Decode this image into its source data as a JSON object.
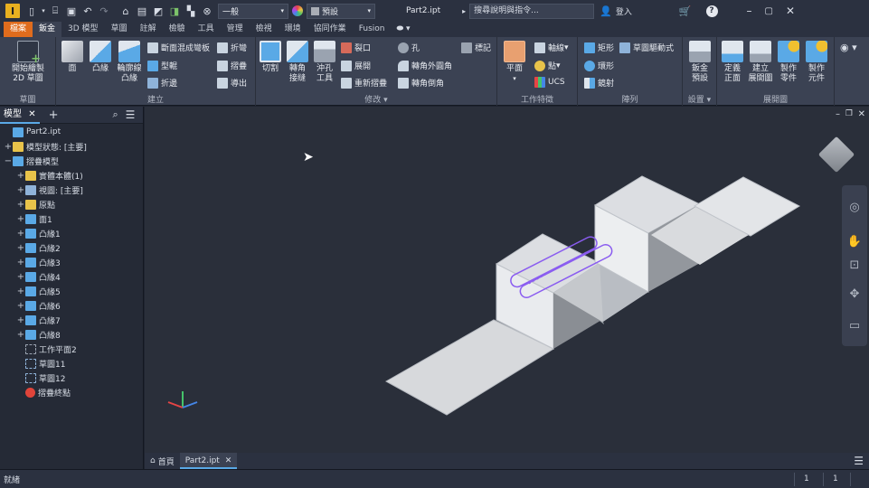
{
  "titlebar": {
    "app_letter": "I",
    "style_select": "一般",
    "appearance_select": "預設",
    "doc_title": "Part2.ipt",
    "search_placeholder": "搜尋說明與指令...",
    "signin": "登入",
    "help_icon": "?"
  },
  "menu_tabs": [
    "檔案",
    "鈑金",
    "3D 模型",
    "草圖",
    "註解",
    "檢驗",
    "工具",
    "管理",
    "檢視",
    "環境",
    "協同作業",
    "Fusion"
  ],
  "ribbon": {
    "sketch_panel": {
      "label": "草圖",
      "start_sketch": "開始繪製\n2D 草圖"
    },
    "create_panel": {
      "label": "建立",
      "face": "面",
      "contour_flange": "凸緣",
      "contour_roll": "輪廓線\n凸緣",
      "lofted_flange": "斷面混成彎板",
      "contour": "型輥",
      "fold": "折邊",
      "bend": "折彎",
      "fold2": "摺疊",
      "export": "導出"
    },
    "modify_panel": {
      "label": "修改",
      "cut": "切割",
      "corner_seam": "轉角\n接縫",
      "punch": "沖孔\n工具",
      "rip": "裂口",
      "unfold": "展開",
      "refold": "重新摺疊",
      "hole": "孔",
      "corner_round": "轉角外圓角",
      "corner_chamfer": "轉角倒角",
      "mark": "標記"
    },
    "work_panel": {
      "label": "工作特徵",
      "plane": "平面",
      "axis": "軸線",
      "point": "點",
      "ucs": "UCS"
    },
    "pattern_panel": {
      "label": "陣列",
      "rect": "矩形",
      "circular": "環形",
      "mirror": "鏡射",
      "sketch_driven": "草圖驅動式"
    },
    "setup_panel": {
      "label": "設置",
      "defaults": "鈑金\n預設"
    },
    "flat_panel": {
      "label": "展開圖",
      "define_face": "定義\n正面",
      "create_flat": "建立\n展開圖",
      "make_part": "製作\n零件",
      "make_component": "製作\n元件"
    }
  },
  "browser": {
    "tab_label": "模型",
    "items": [
      {
        "label": "Part2.ipt",
        "exp": "",
        "indent": 0,
        "icon": "part-icon",
        "color": "#5aa9e6"
      },
      {
        "label": "模型狀態: [主要]",
        "exp": "+",
        "indent": 0,
        "icon": "folder-icon",
        "color": "#e8c34a"
      },
      {
        "label": "摺疊模型",
        "exp": "−",
        "indent": 0,
        "icon": "sheetmetal-icon",
        "color": "#5aa9e6"
      },
      {
        "label": "實體本體(1)",
        "exp": "+",
        "indent": 1,
        "icon": "folder-icon",
        "color": "#e8c34a"
      },
      {
        "label": "視圖: [主要]",
        "exp": "+",
        "indent": 1,
        "icon": "view-icon",
        "color": "#8fb3d9"
      },
      {
        "label": "原點",
        "exp": "+",
        "indent": 1,
        "icon": "folder-icon",
        "color": "#e8c34a"
      },
      {
        "label": "面1",
        "exp": "+",
        "indent": 1,
        "icon": "face-icon",
        "color": "#5aa9e6"
      },
      {
        "label": "凸緣1",
        "exp": "+",
        "indent": 1,
        "icon": "flange-icon",
        "color": "#5aa9e6"
      },
      {
        "label": "凸緣2",
        "exp": "+",
        "indent": 1,
        "icon": "flange-icon",
        "color": "#5aa9e6"
      },
      {
        "label": "凸緣3",
        "exp": "+",
        "indent": 1,
        "icon": "flange-icon",
        "color": "#5aa9e6"
      },
      {
        "label": "凸緣4",
        "exp": "+",
        "indent": 1,
        "icon": "flange-icon",
        "color": "#5aa9e6"
      },
      {
        "label": "凸緣5",
        "exp": "+",
        "indent": 1,
        "icon": "flange-icon",
        "color": "#5aa9e6"
      },
      {
        "label": "凸緣6",
        "exp": "+",
        "indent": 1,
        "icon": "flange-icon",
        "color": "#5aa9e6"
      },
      {
        "label": "凸緣7",
        "exp": "+",
        "indent": 1,
        "icon": "flange-icon",
        "color": "#5aa9e6"
      },
      {
        "label": "凸緣8",
        "exp": "+",
        "indent": 1,
        "icon": "flange-icon",
        "color": "#5aa9e6"
      },
      {
        "label": "工作平面2",
        "exp": "",
        "indent": 1,
        "icon": "workplane-icon",
        "color": "#9aa3b0"
      },
      {
        "label": "草圖11",
        "exp": "",
        "indent": 1,
        "icon": "sketch-icon",
        "color": "#8fb3d9"
      },
      {
        "label": "草圖12",
        "exp": "",
        "indent": 1,
        "icon": "sketch-icon",
        "color": "#8fb3d9"
      },
      {
        "label": "摺疊終點",
        "exp": "",
        "indent": 1,
        "icon": "end-of-folded-icon",
        "color": "#e0443a"
      }
    ]
  },
  "doc_tabs": {
    "home": "首頁",
    "part": "Part2.ipt"
  },
  "status": {
    "text": "就緒",
    "count1": "1",
    "count2": "1"
  },
  "colors": {
    "accent": "#e06c1d",
    "viewport": "#2a2f3a",
    "selection": "#8a5cf0"
  }
}
